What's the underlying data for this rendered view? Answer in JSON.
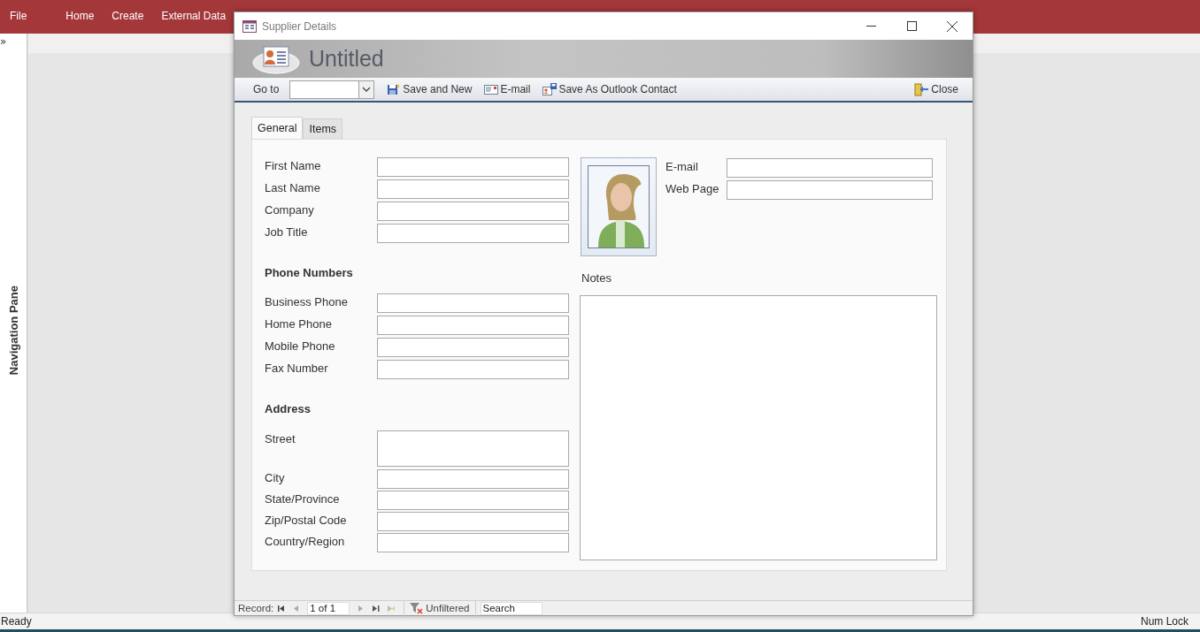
{
  "ribbon": {
    "tabs": [
      {
        "label": "File",
        "selected": false
      },
      {
        "label": "Home",
        "selected": false
      },
      {
        "label": "Create",
        "selected": false
      },
      {
        "label": "External Data",
        "selected": false
      }
    ]
  },
  "navigation_pane": {
    "toggle": "»",
    "title": "Navigation Pane"
  },
  "dialog": {
    "title": "Supplier Details",
    "heading": "Untitled",
    "toolbar": {
      "goto_label": "Go to",
      "buttons": [
        {
          "label": "Save and New",
          "kind": "save"
        },
        {
          "label": "E-mail",
          "kind": "email"
        },
        {
          "label": "Save As Outlook Contact",
          "kind": "contact"
        },
        {
          "label": "Close",
          "kind": "close"
        }
      ]
    },
    "tabs": [
      {
        "label": "General",
        "selected": true
      },
      {
        "label": "Items",
        "selected": false
      }
    ],
    "sections": [
      {
        "fields": [
          {
            "label": "First Name",
            "kind": "text"
          },
          {
            "label": "Last Name",
            "kind": "text"
          },
          {
            "label": "Company",
            "kind": "text"
          },
          {
            "label": "Job Title",
            "kind": "text"
          }
        ]
      },
      {
        "heading": "Phone Numbers",
        "fields": [
          {
            "label": "Business Phone",
            "kind": "text"
          },
          {
            "label": "Home Phone",
            "kind": "text"
          },
          {
            "label": "Mobile Phone",
            "kind": "text"
          },
          {
            "label": "Fax Number",
            "kind": "text"
          }
        ]
      },
      {
        "heading": "Address",
        "fields": [
          {
            "label": "Street",
            "kind": "multiline"
          },
          {
            "label": "City",
            "kind": "text"
          },
          {
            "label": "State/Province",
            "kind": "text"
          },
          {
            "label": "Zip/Postal Code",
            "kind": "text"
          },
          {
            "label": "Country/Region",
            "kind": "text"
          }
        ]
      }
    ],
    "contact_fields": [
      {
        "label": "E-mail"
      },
      {
        "label": "Web Page"
      }
    ],
    "notes_label": "Notes",
    "record_bar": {
      "label": "Record:",
      "position": "1 of 1",
      "filter": "Unfiltered",
      "search_placeholder": "Search"
    }
  },
  "status_bar": {
    "left": "Ready",
    "right": "Num Lock"
  }
}
